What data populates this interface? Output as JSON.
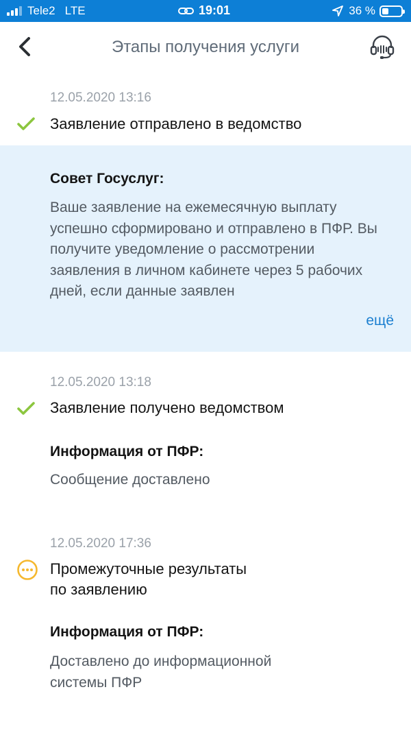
{
  "status_bar": {
    "carrier": "Tele2",
    "network": "LTE",
    "time": "19:01",
    "battery": "36 %",
    "battery_level": 0.36
  },
  "header": {
    "title": "Этапы получения услуги",
    "back_icon": "chevron-left-icon",
    "support_icon": "headset-icon"
  },
  "colors": {
    "status_bar": "#0d7fd6",
    "check": "#8cc63f",
    "pending": "#f5b82e",
    "tip_background": "#e5f2fc",
    "link": "#1b7fd0"
  },
  "stages": [
    {
      "date": "12.05.2020 13:16",
      "title": "Заявление отправлено в ведомство",
      "status_icon": "check-icon",
      "tip": {
        "title": "Совет Госуслуг:",
        "text": "Ваше заявление на ежемесячную выплату успешно сформировано и отправлено в ПФР. Вы получите уведомление о рассмотрении заявления в личном кабинете через 5 рабочих дней, если данные заявлен",
        "more": "ещё"
      }
    },
    {
      "date": "12.05.2020 13:18",
      "title": "Заявление получено ведомством",
      "status_icon": "check-icon",
      "info_title": "Информация от ПФР:",
      "info_text": "Сообщение доставлено"
    },
    {
      "date": "12.05.2020 17:36",
      "title_line1": "Промежуточные результаты",
      "title_line2": "по заявлению",
      "status_icon": "more-horizontal-icon",
      "info_title": "Информация от ПФР:",
      "info_text_line1": "Доставлено до информационной",
      "info_text_line2": "системы ПФР"
    }
  ]
}
